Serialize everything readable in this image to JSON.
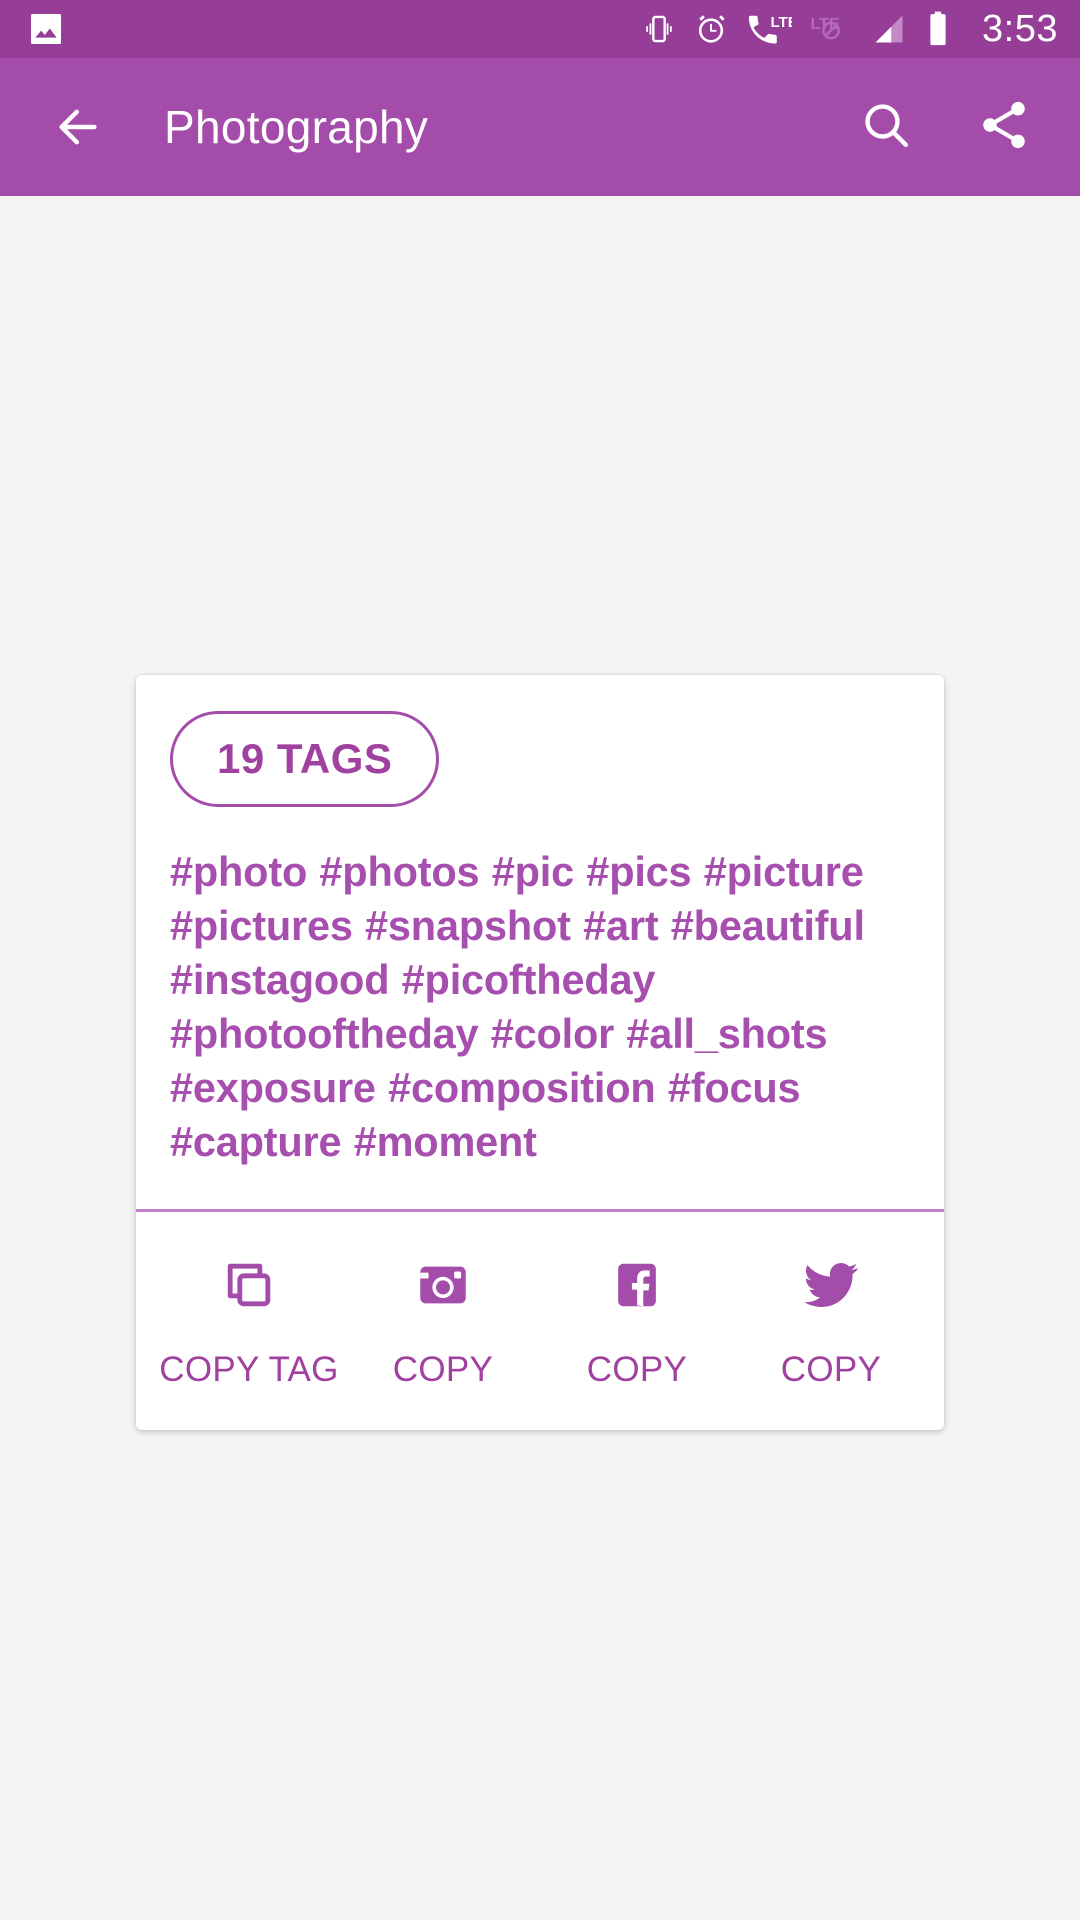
{
  "status_bar": {
    "time": "3:53",
    "background_color": "#963d98",
    "icons": [
      {
        "name": "photo-gallery-icon",
        "position": "left"
      },
      {
        "name": "vibrate-mode-icon",
        "position": "right"
      },
      {
        "name": "alarm-clock-icon",
        "position": "right"
      },
      {
        "name": "lte-call-icon",
        "label": "LTE",
        "position": "right"
      },
      {
        "name": "lte-disabled-icon",
        "label": "LTE",
        "position": "right"
      },
      {
        "name": "signal-strength-icon",
        "position": "right"
      },
      {
        "name": "battery-full-icon",
        "position": "right"
      }
    ]
  },
  "app_bar": {
    "title": "Photography",
    "background_color": "#a44caa",
    "back_icon": "arrow-back-icon",
    "search_icon": "search-icon",
    "share_icon": "share-icon"
  },
  "card": {
    "badge_label": "19 TAGS",
    "accent_color": "#a0419f",
    "tag_text": "#photo #photos #pic #pics #picture #pictures #snapshot #art #beautiful #instagood #picoftheday #photooftheday #color #all_shots #exposure #composition #focus #capture #moment",
    "tags": [
      "#photo",
      "#photos",
      "#pic",
      "#pics",
      "#picture",
      "#pictures",
      "#snapshot",
      "#art",
      "#beautiful",
      "#instagood",
      "#picoftheday",
      "#photooftheday",
      "#color",
      "#all_shots",
      "#exposure",
      "#composition",
      "#focus",
      "#capture",
      "#moment"
    ],
    "actions": [
      {
        "icon": "copy-icon",
        "label": "COPY TAG"
      },
      {
        "icon": "instagram-icon",
        "label": "COPY"
      },
      {
        "icon": "facebook-icon",
        "label": "COPY"
      },
      {
        "icon": "twitter-icon",
        "label": "COPY"
      }
    ]
  }
}
